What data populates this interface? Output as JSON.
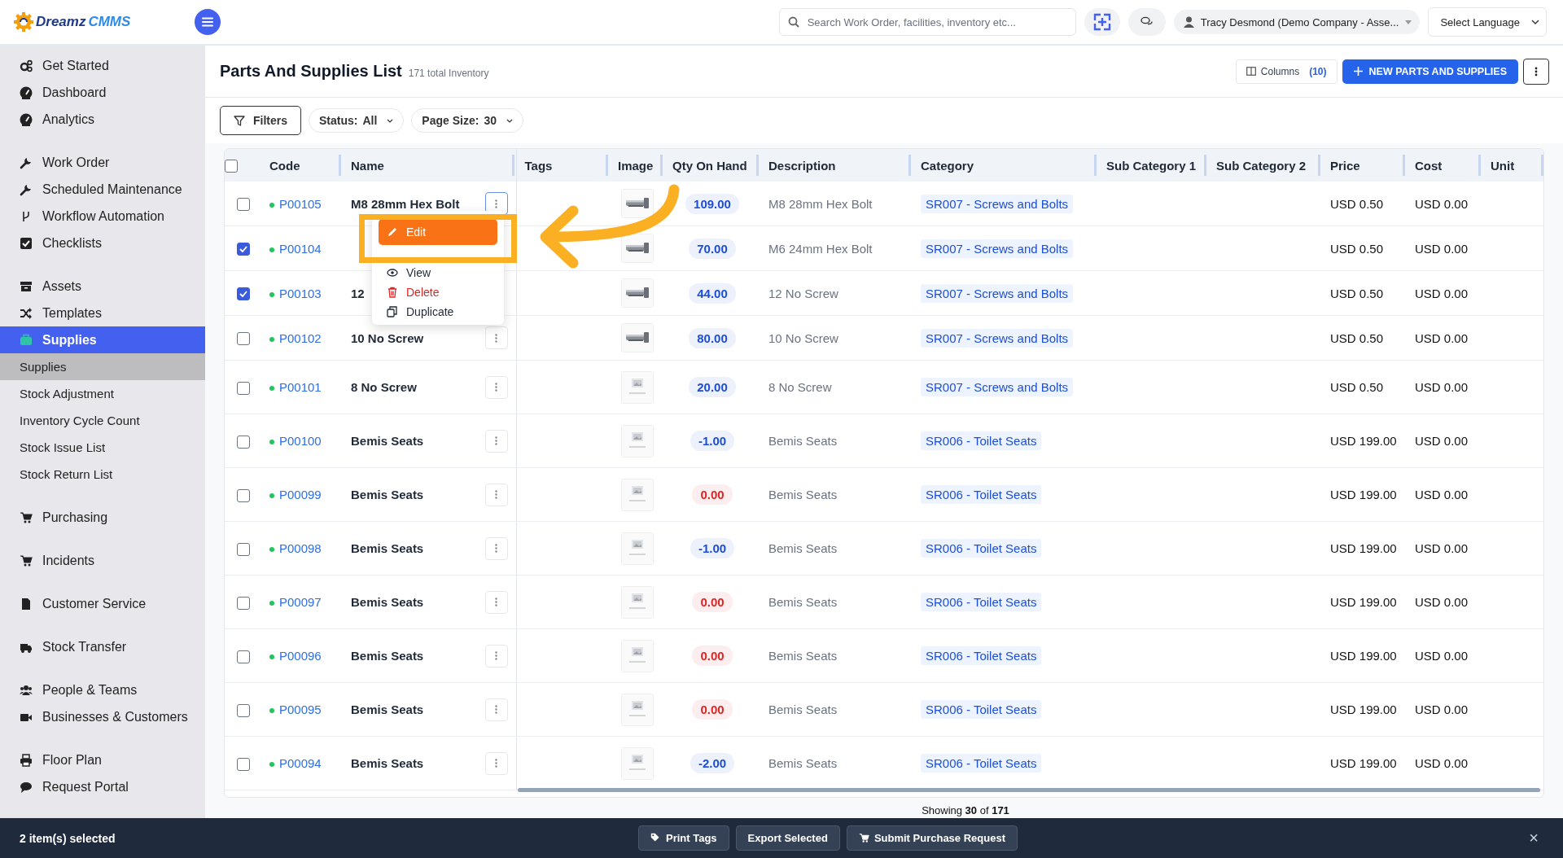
{
  "logo": {
    "name": "Dreamz",
    "accent": "CMMS"
  },
  "topbar": {
    "search": {
      "placeholder": "Search Work Order, facilities, inventory etc..."
    },
    "user": "Tracy Desmond (Demo Company - Asse...",
    "language": "Select Language"
  },
  "sidebar": {
    "groups": [
      {
        "items": [
          {
            "label": "Get Started",
            "kind": "main",
            "selected": false
          },
          {
            "label": "Dashboard",
            "kind": "main",
            "selected": false
          },
          {
            "label": "Analytics",
            "kind": "main",
            "selected": false
          }
        ]
      },
      {
        "items": [
          {
            "label": "Work Order",
            "kind": "main",
            "selected": false
          },
          {
            "label": "Scheduled Maintenance",
            "kind": "main",
            "selected": false
          },
          {
            "label": "Workflow Automation",
            "kind": "main",
            "selected": false
          },
          {
            "label": "Checklists",
            "kind": "main",
            "selected": false
          }
        ]
      },
      {
        "items": [
          {
            "label": "Assets",
            "kind": "main",
            "selected": false
          },
          {
            "label": "Templates",
            "kind": "main",
            "selected": false
          },
          {
            "label": "Supplies",
            "kind": "main",
            "selected": true
          },
          {
            "label": "Supplies",
            "kind": "sub",
            "selected": true
          },
          {
            "label": "Stock Adjustment",
            "kind": "sub",
            "selected": false
          },
          {
            "label": "Inventory Cycle Count",
            "kind": "sub",
            "selected": false
          },
          {
            "label": "Stock Issue List",
            "kind": "sub",
            "selected": false
          },
          {
            "label": "Stock Return List",
            "kind": "sub",
            "selected": false
          }
        ]
      },
      {
        "items": [
          {
            "label": "Purchasing",
            "kind": "main",
            "selected": false
          }
        ]
      },
      {
        "items": [
          {
            "label": "Incidents",
            "kind": "main",
            "selected": false
          }
        ]
      },
      {
        "items": [
          {
            "label": "Customer Service",
            "kind": "main",
            "selected": false
          }
        ]
      },
      {
        "items": [
          {
            "label": "Stock Transfer",
            "kind": "main",
            "selected": false
          }
        ]
      },
      {
        "items": [
          {
            "label": "People & Teams",
            "kind": "main",
            "selected": false
          },
          {
            "label": "Businesses & Customers",
            "kind": "main",
            "selected": false
          }
        ]
      },
      {
        "items": [
          {
            "label": "Floor Plan",
            "kind": "main",
            "selected": false
          },
          {
            "label": "Request Portal",
            "kind": "main",
            "selected": false
          }
        ]
      }
    ]
  },
  "page": {
    "title": "Parts And Supplies List",
    "subtitle": "171 total Inventory",
    "columns_button": {
      "label": "Columns",
      "count": "(10)"
    },
    "new_button": "NEW PARTS AND SUPPLIES"
  },
  "filters": [
    {
      "kind": "button",
      "label": "Filters"
    },
    {
      "kind": "select",
      "label": "Status:",
      "value": "All"
    },
    {
      "kind": "select",
      "label": "Page Size:",
      "value": "30"
    }
  ],
  "table": {
    "select_all": {
      "checked": false
    },
    "columns": [
      "Code",
      "Name",
      "Tags",
      "Image",
      "Qty On Hand",
      "Description",
      "Category",
      "Sub Category 1",
      "Sub Category 2",
      "Price",
      "Cost",
      "Unit"
    ],
    "rows": [
      {
        "checked": false,
        "color": "#22c55e",
        "code": "P00105",
        "name": "M8 28mm Hex Bolt",
        "menu_button": true,
        "menu_open": true,
        "has_image": true,
        "qty": {
          "text": "109.00",
          "color": "#1d4ed8"
        },
        "description": "M8 28mm Hex Bolt",
        "category": "SR007 - Screws and Bolts",
        "price": "USD 0.50",
        "cost": "USD 0.00"
      },
      {
        "checked": true,
        "color": "#22c55e",
        "code": "P00104",
        "menu_button": false,
        "menu_open": false,
        "has_image": true,
        "qty": {
          "text": "70.00",
          "color": "#1d4ed8"
        },
        "description": "M6 24mm Hex Bolt",
        "category": "SR007 - Screws and Bolts",
        "price": "USD 0.50",
        "cost": "USD 0.00"
      },
      {
        "checked": true,
        "color": "#22c55e",
        "code": "P00103",
        "name": "12",
        "menu_button": false,
        "menu_open": false,
        "has_image": true,
        "qty": {
          "text": "44.00",
          "color": "#1d4ed8"
        },
        "description": "12 No Screw",
        "category": "SR007 - Screws and Bolts",
        "price": "USD 0.50",
        "cost": "USD 0.00"
      },
      {
        "checked": false,
        "color": "#22c55e",
        "code": "P00102",
        "name": "10 No Screw",
        "menu_button": true,
        "menu_open": false,
        "has_image": true,
        "qty": {
          "text": "80.00",
          "color": "#1d4ed8"
        },
        "description": "10 No Screw",
        "category": "SR007 - Screws and Bolts",
        "price": "USD 0.50",
        "cost": "USD 0.00"
      },
      {
        "checked": false,
        "color": "#22c55e",
        "code": "P00101",
        "name": "8 No Screw",
        "menu_button": true,
        "menu_open": false,
        "has_image": false,
        "qty": {
          "text": "20.00",
          "color": "#1d4ed8"
        },
        "description": "8 No Screw",
        "category": "SR007 - Screws and Bolts",
        "price": "USD 0.50",
        "cost": "USD 0.00"
      },
      {
        "checked": false,
        "color": "#22c55e",
        "code": "P00100",
        "name": "Bemis Seats",
        "menu_button": true,
        "menu_open": false,
        "has_image": false,
        "qty": {
          "text": "-1.00",
          "color": "#1d4ed8"
        },
        "description": "Bemis Seats",
        "category": "SR006 - Toilet Seats",
        "price": "USD 199.00",
        "cost": "USD 0.00"
      },
      {
        "checked": false,
        "color": "#22c55e",
        "code": "P00099",
        "name": "Bemis Seats",
        "menu_button": true,
        "menu_open": false,
        "has_image": false,
        "qty": {
          "text": "0.00",
          "color": "#dc2626"
        },
        "description": "Bemis Seats",
        "category": "SR006 - Toilet Seats",
        "price": "USD 199.00",
        "cost": "USD 0.00"
      },
      {
        "checked": false,
        "color": "#22c55e",
        "code": "P00098",
        "name": "Bemis Seats",
        "menu_button": true,
        "menu_open": false,
        "has_image": false,
        "qty": {
          "text": "-1.00",
          "color": "#1d4ed8"
        },
        "description": "Bemis Seats",
        "category": "SR006 - Toilet Seats",
        "price": "USD 199.00",
        "cost": "USD 0.00"
      },
      {
        "checked": false,
        "color": "#22c55e",
        "code": "P00097",
        "name": "Bemis Seats",
        "menu_button": true,
        "menu_open": false,
        "has_image": false,
        "qty": {
          "text": "0.00",
          "color": "#dc2626"
        },
        "description": "Bemis Seats",
        "category": "SR006 - Toilet Seats",
        "price": "USD 199.00",
        "cost": "USD 0.00"
      },
      {
        "checked": false,
        "color": "#22c55e",
        "code": "P00096",
        "name": "Bemis Seats",
        "menu_button": true,
        "menu_open": false,
        "has_image": false,
        "qty": {
          "text": "0.00",
          "color": "#dc2626"
        },
        "description": "Bemis Seats",
        "category": "SR006 - Toilet Seats",
        "price": "USD 199.00",
        "cost": "USD 0.00"
      },
      {
        "checked": false,
        "color": "#22c55e",
        "code": "P00095",
        "name": "Bemis Seats",
        "menu_button": true,
        "menu_open": false,
        "has_image": false,
        "qty": {
          "text": "0.00",
          "color": "#dc2626"
        },
        "description": "Bemis Seats",
        "category": "SR006 - Toilet Seats",
        "price": "USD 199.00",
        "cost": "USD 0.00"
      },
      {
        "checked": false,
        "color": "#22c55e",
        "code": "P00094",
        "name": "Bemis Seats",
        "menu_button": true,
        "menu_open": false,
        "has_image": false,
        "qty": {
          "text": "-2.00",
          "color": "#1d4ed8"
        },
        "description": "Bemis Seats",
        "category": "SR006 - Toilet Seats",
        "price": "USD 199.00",
        "cost": "USD 0.00"
      }
    ],
    "row_menu": [
      {
        "label": "Edit",
        "kind": "normal",
        "selected": true
      },
      {
        "label": "View",
        "kind": "normal",
        "selected": false
      },
      {
        "label": "Delete",
        "kind": "danger",
        "selected": false
      },
      {
        "label": "Duplicate",
        "kind": "normal",
        "selected": false
      }
    ],
    "footer": "Showing **30** of **171**"
  },
  "selection_bar": {
    "count": "2 item(s) selected",
    "actions": [
      "Print Tags",
      "Export Selected",
      "Submit Purchase Request"
    ],
    "close": "×"
  }
}
